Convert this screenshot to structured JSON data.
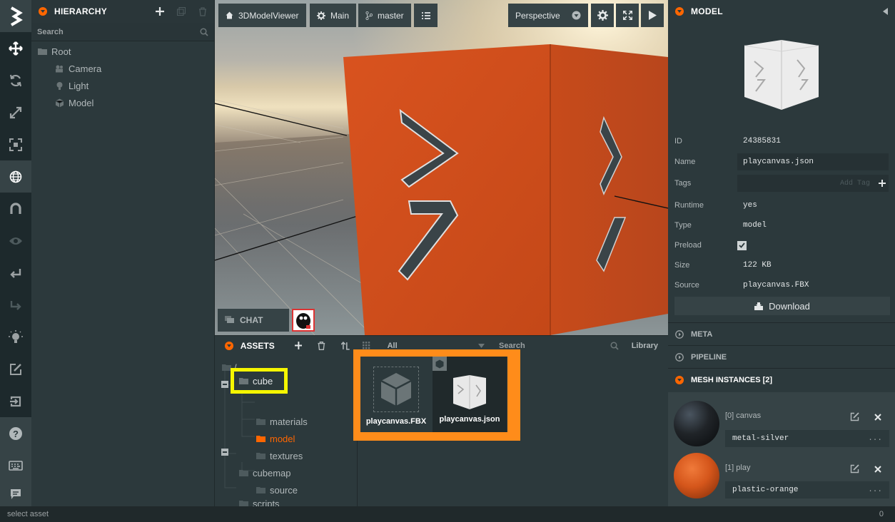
{
  "toolbar": {
    "tools": [
      {
        "icon": "logo-icon"
      },
      {
        "icon": "translate-icon"
      },
      {
        "icon": "rotate-icon"
      },
      {
        "icon": "scale-icon"
      },
      {
        "icon": "resize-icon"
      },
      {
        "icon": "world-icon"
      },
      {
        "icon": "snap-icon"
      },
      {
        "icon": "eye-icon"
      },
      {
        "icon": "undo-icon"
      },
      {
        "icon": "redo-icon"
      },
      {
        "icon": "lightmap-icon"
      },
      {
        "icon": "code-editor-icon"
      },
      {
        "icon": "publish-icon"
      },
      {
        "icon": "help-icon"
      },
      {
        "icon": "keyboard-icon"
      },
      {
        "icon": "chat-icon"
      }
    ]
  },
  "hierarchy": {
    "title": "HIERARCHY",
    "search_placeholder": "Search",
    "items": {
      "root": "Root",
      "camera": "Camera",
      "light": "Light",
      "model": "Model"
    }
  },
  "viewport": {
    "project": "3DModelViewer",
    "scene": "Main",
    "branch": "master",
    "camera": "Perspective",
    "chat": "CHAT"
  },
  "assets": {
    "title": "ASSETS",
    "filter": "All",
    "search": "Search",
    "library": "Library",
    "folders": {
      "root": "/",
      "cube": "cube",
      "materials": "materials",
      "model": "model",
      "textures": "textures",
      "cubemap": "cubemap",
      "source": "source",
      "scripts": "scripts"
    },
    "files": {
      "fbx": "playcanvas.FBX",
      "json": "playcanvas.json"
    }
  },
  "inspector": {
    "title": "MODEL",
    "fields": {
      "id_label": "ID",
      "id": "24385831",
      "name_label": "Name",
      "name": "playcanvas.json",
      "tags_label": "Tags",
      "tags_placeholder": "Add Tag",
      "runtime_label": "Runtime",
      "runtime": "yes",
      "type_label": "Type",
      "type": "model",
      "preload_label": "Preload",
      "size_label": "Size",
      "size": "122 KB",
      "source_label": "Source",
      "source": "playcanvas.FBX"
    },
    "download": "Download",
    "sections": {
      "meta": "META",
      "pipeline": "PIPELINE",
      "mesh": "MESH INSTANCES [2]"
    },
    "mesh_instances": [
      {
        "label": "[0] canvas",
        "material": "metal-silver",
        "more": "..."
      },
      {
        "label": "[1] play",
        "material": "plastic-orange",
        "more": "..."
      }
    ]
  },
  "status": {
    "text": "select asset",
    "count": "0"
  },
  "colors": {
    "accent": "#ff6600",
    "highlight_yellow": "#f5f500",
    "highlight_orange": "#ff8c1a"
  }
}
